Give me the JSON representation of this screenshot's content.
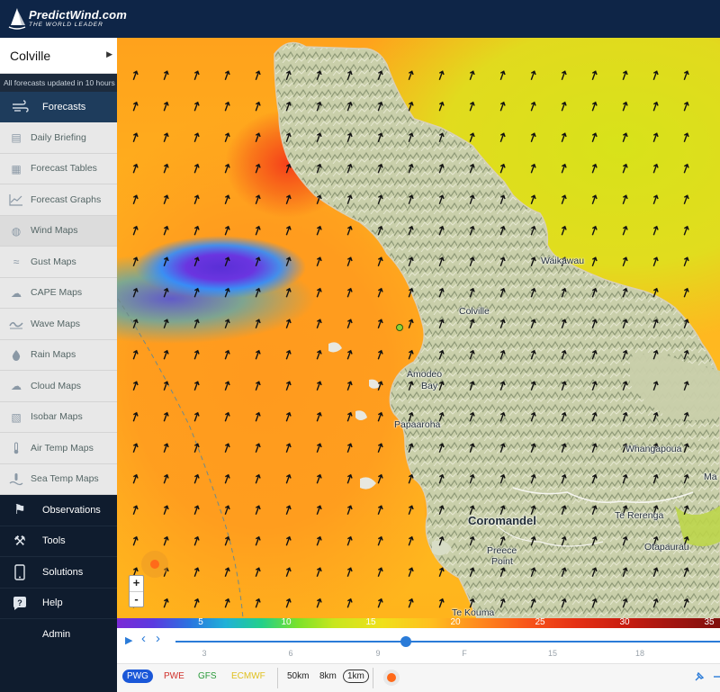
{
  "brand": {
    "name": "PredictWind.com",
    "tagline": "THE WORLD LEADER"
  },
  "sidebar": {
    "location": "Colville",
    "update_note": "All forecasts updated in 10 hours",
    "forecasts_label": "Forecasts",
    "sub_items": [
      {
        "label": "Daily Briefing",
        "icon": "document-icon"
      },
      {
        "label": "Forecast Tables",
        "icon": "table-icon"
      },
      {
        "label": "Forecast Graphs",
        "icon": "graph-icon"
      },
      {
        "label": "Wind Maps",
        "icon": "globe-icon"
      },
      {
        "label": "Gust Maps",
        "icon": "gust-icon"
      },
      {
        "label": "CAPE Maps",
        "icon": "cloud-lightning-icon"
      },
      {
        "label": "Wave Maps",
        "icon": "wave-icon"
      },
      {
        "label": "Rain Maps",
        "icon": "raindrop-icon"
      },
      {
        "label": "Cloud Maps",
        "icon": "cloud-icon"
      },
      {
        "label": "Isobar Maps",
        "icon": "isobar-icon"
      },
      {
        "label": "Air Temp Maps",
        "icon": "thermometer-icon"
      },
      {
        "label": "Sea Temp Maps",
        "icon": "sea-temp-icon"
      }
    ],
    "bottom_items": [
      {
        "label": "Observations",
        "icon": "flags-icon"
      },
      {
        "label": "Tools",
        "icon": "hammer-icon"
      },
      {
        "label": "Solutions",
        "icon": "phone-icon"
      },
      {
        "label": "Help",
        "icon": "help-icon"
      },
      {
        "label": "Admin",
        "icon": ""
      }
    ]
  },
  "map": {
    "places": {
      "waikawau": "Waikawau",
      "colville": "Colville",
      "amodeo": "Amodeo",
      "bay": "Bay",
      "papaaroha": "Papaaroha",
      "whangapoua": "Whangapoua",
      "coromandel": "Coromandel",
      "te_rerenga": "Te Rerenga",
      "preece": "Preece",
      "point": "Point",
      "otapaurau": "Otapaurau",
      "te_kouma": "Te Kouma",
      "ma": "Ma"
    },
    "zoom_in": "+",
    "zoom_out": "-"
  },
  "legend": {
    "ticks": [
      "5",
      "10",
      "15",
      "20",
      "25",
      "30",
      "35"
    ]
  },
  "timeline": {
    "play": "▶",
    "prev": "‹",
    "next": "›",
    "ticks": [
      "3",
      "6",
      "9",
      "F",
      "15",
      "18"
    ],
    "position": 0.42
  },
  "models": [
    {
      "label": "PWG",
      "color": "#ffffff",
      "active": true
    },
    {
      "label": "PWE",
      "color": "#d0302a"
    },
    {
      "label": "GFS",
      "color": "#2a9a3a"
    },
    {
      "label": "ECMWF",
      "color": "#e0c020"
    }
  ],
  "resolutions": [
    {
      "label": "50km"
    },
    {
      "label": "8km"
    },
    {
      "label": "1km",
      "active": true
    }
  ]
}
